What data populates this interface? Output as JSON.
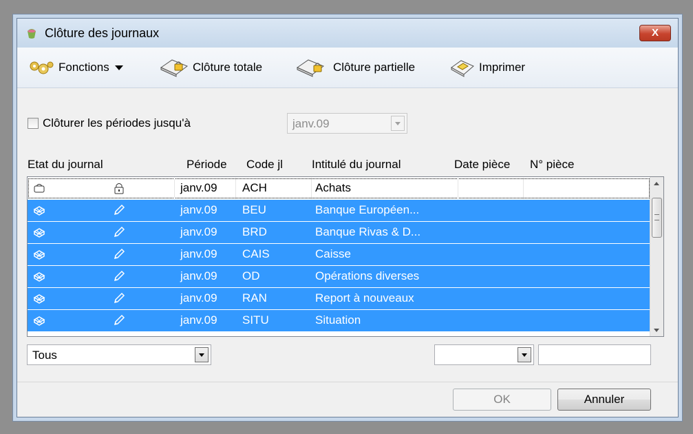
{
  "window": {
    "title": "Clôture des journaux",
    "close_glyph": "X"
  },
  "toolbar": {
    "functions_label": "Fonctions",
    "close_total_label": "Clôture totale",
    "close_partial_label": "Clôture partielle",
    "print_label": "Imprimer"
  },
  "period_filter": {
    "checkbox_label": "Clôturer les périodes jusqu'à",
    "checked": false,
    "period_value": "janv.09"
  },
  "columns": {
    "state": "Etat du journal",
    "period": "Période",
    "code": "Code jl",
    "title": "Intitulé du journal",
    "doc_date": "Date pièce",
    "doc_num": "N° pièce"
  },
  "rows": [
    {
      "state_icon": "closed-journal-icon",
      "lock_icon": "padlock-icon",
      "period": "janv.09",
      "code": "ACH",
      "title": "Achats",
      "selected": false
    },
    {
      "state_icon": "open-journal-icon",
      "lock_icon": "pencil-icon",
      "period": "janv.09",
      "code": "BEU",
      "title": "Banque Européen...",
      "selected": true
    },
    {
      "state_icon": "open-journal-icon",
      "lock_icon": "pencil-icon",
      "period": "janv.09",
      "code": "BRD",
      "title": "Banque Rivas & D...",
      "selected": true
    },
    {
      "state_icon": "open-journal-icon",
      "lock_icon": "pencil-icon",
      "period": "janv.09",
      "code": "CAIS",
      "title": "Caisse",
      "selected": true
    },
    {
      "state_icon": "open-journal-icon",
      "lock_icon": "pencil-icon",
      "period": "janv.09",
      "code": "OD",
      "title": "Opérations diverses",
      "selected": true
    },
    {
      "state_icon": "open-journal-icon",
      "lock_icon": "pencil-icon",
      "period": "janv.09",
      "code": "RAN",
      "title": "Report à nouveaux",
      "selected": true
    },
    {
      "state_icon": "open-journal-icon",
      "lock_icon": "pencil-icon",
      "period": "janv.09",
      "code": "SITU",
      "title": "Situation",
      "selected": true
    }
  ],
  "filters": {
    "state_value": "Tous",
    "date_value": "",
    "num_value": ""
  },
  "buttons": {
    "ok_label": "OK",
    "cancel_label": "Annuler"
  },
  "colors": {
    "selection": "#3399ff",
    "titlebar": "#c6d8eb"
  }
}
